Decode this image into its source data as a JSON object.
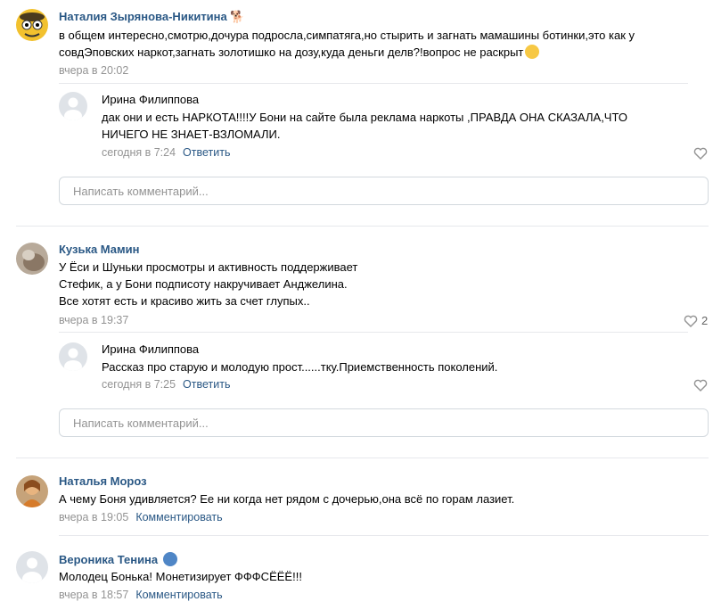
{
  "comments": [
    {
      "author": "Наталия Зырянова-Никитина",
      "author_icon": "dog-emoji",
      "lines": [
        "в общем интересно,смотрю,дочура подросла,симпатяга,но стырить и загнать мамашины ботинки,это как у",
        "совдЭповских наркот,загнать золотишко на дозу,куда деньги делв?!вопрос не раскрыт"
      ],
      "time": "вчера в 20:02",
      "reply": {
        "author": "Ирина Филиппова",
        "lines": [
          "дак они и есть НАРКОТА!!!!У Бони на сайте была реклама наркоты ,ПРАВДА ОНА СКАЗАЛА,ЧТО",
          "НИЧЕГО НЕ ЗНАЕТ-ВЗЛОМАЛИ."
        ],
        "time": "сегодня в 7:24",
        "action": "Ответить"
      },
      "input_placeholder": "Написать комментарий..."
    },
    {
      "author": "Кузька Мамин",
      "lines": [
        "У Ёси и Шуньки просмотры и активность поддерживает",
        "Стефик, а у Бони подписоту накручивает Анджелина.",
        "Все хотят есть и красиво жить за счет глупых.."
      ],
      "time": "вчера в 19:37",
      "likes": "2",
      "reply": {
        "author": "Ирина Филиппова",
        "lines": [
          "Рассказ про старую и молодую прост......тку.Приемственность поколений."
        ],
        "time": "сегодня в 7:25",
        "action": "Ответить"
      },
      "input_placeholder": "Написать комментарий..."
    },
    {
      "author": "Наталья Мороз",
      "lines": [
        "А чему Боня удивляется? Ее ни когда нет рядом с дочерью,она всё по горам лазиет."
      ],
      "time": "вчера в 19:05",
      "action": "Комментировать"
    },
    {
      "author": "Вероника Тенина",
      "author_icon": "mask-emoji",
      "lines": [
        "Молодец Бонька! Монетизирует ФФФСЁЁЁ!!!"
      ],
      "time": "вчера в 18:57",
      "action": "Комментировать"
    }
  ],
  "colors": {
    "link": "#2a5885",
    "muted": "#939393",
    "border": "#d3d9de"
  }
}
